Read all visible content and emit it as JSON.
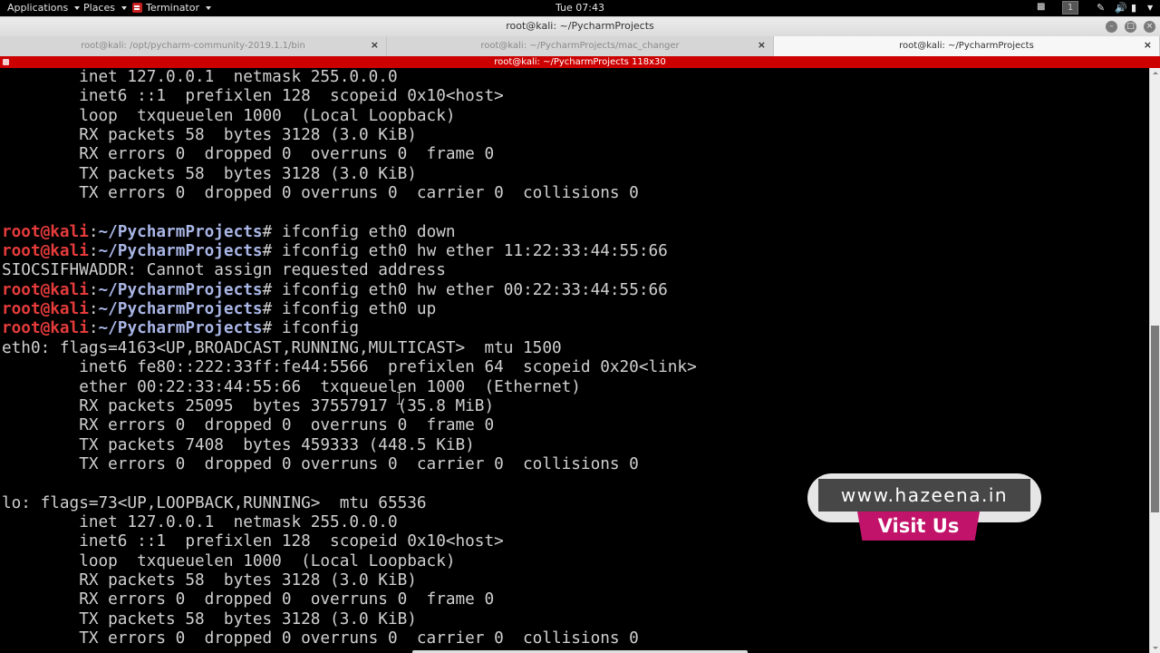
{
  "top_panel": {
    "applications_label": "Applications",
    "places_label": "Places",
    "terminator_label": "Terminator",
    "clock": "Tue 07:43",
    "workspace_number": "1"
  },
  "window": {
    "title": "root@kali: ~/PycharmProjects"
  },
  "tabs": [
    {
      "label": "root@kali: /opt/pycharm-community-2019.1.1/bin",
      "close": "×",
      "active": false
    },
    {
      "label": "root@kali: ~/PycharmProjects/mac_changer",
      "close": "×",
      "active": false
    },
    {
      "label": "root@kali: ~/PycharmProjects",
      "close": "×",
      "active": true
    }
  ],
  "terminal": {
    "title": "root@kali: ~/PycharmProjects 118x30",
    "prompt": {
      "user": "root@kali",
      "sep": ":",
      "path": "~/PycharmProjects",
      "symbol": "# "
    },
    "lines": [
      {
        "type": "out",
        "text": "        inet 127.0.0.1  netmask 255.0.0.0"
      },
      {
        "type": "out",
        "text": "        inet6 ::1  prefixlen 128  scopeid 0x10<host>"
      },
      {
        "type": "out",
        "text": "        loop  txqueuelen 1000  (Local Loopback)"
      },
      {
        "type": "out",
        "text": "        RX packets 58  bytes 3128 (3.0 KiB)"
      },
      {
        "type": "out",
        "text": "        RX errors 0  dropped 0  overruns 0  frame 0"
      },
      {
        "type": "out",
        "text": "        TX packets 58  bytes 3128 (3.0 KiB)"
      },
      {
        "type": "out",
        "text": "        TX errors 0  dropped 0 overruns 0  carrier 0  collisions 0"
      },
      {
        "type": "out",
        "text": ""
      },
      {
        "type": "cmd",
        "text": "ifconfig eth0 down"
      },
      {
        "type": "cmd",
        "text": "ifconfig eth0 hw ether 11:22:33:44:55:66"
      },
      {
        "type": "out",
        "text": "SIOCSIFHWADDR: Cannot assign requested address"
      },
      {
        "type": "cmd",
        "text": "ifconfig eth0 hw ether 00:22:33:44:55:66"
      },
      {
        "type": "cmd",
        "text": "ifconfig eth0 up"
      },
      {
        "type": "cmd",
        "text": "ifconfig"
      },
      {
        "type": "out",
        "text": "eth0: flags=4163<UP,BROADCAST,RUNNING,MULTICAST>  mtu 1500"
      },
      {
        "type": "out",
        "text": "        inet6 fe80::222:33ff:fe44:5566  prefixlen 64  scopeid 0x20<link>"
      },
      {
        "type": "out",
        "text": "        ether 00:22:33:44:55:66  txqueuelen 1000  (Ethernet)"
      },
      {
        "type": "out",
        "text": "        RX packets 25095  bytes 37557917 (35.8 MiB)"
      },
      {
        "type": "out",
        "text": "        RX errors 0  dropped 0  overruns 0  frame 0"
      },
      {
        "type": "out",
        "text": "        TX packets 7408  bytes 459333 (448.5 KiB)"
      },
      {
        "type": "out",
        "text": "        TX errors 0  dropped 0 overruns 0  carrier 0  collisions 0"
      },
      {
        "type": "out",
        "text": ""
      },
      {
        "type": "out",
        "text": "lo: flags=73<UP,LOOPBACK,RUNNING>  mtu 65536"
      },
      {
        "type": "out",
        "text": "        inet 127.0.0.1  netmask 255.0.0.0"
      },
      {
        "type": "out",
        "text": "        inet6 ::1  prefixlen 128  scopeid 0x10<host>"
      },
      {
        "type": "out",
        "text": "        loop  txqueuelen 1000  (Local Loopback)"
      },
      {
        "type": "out",
        "text": "        RX packets 58  bytes 3128 (3.0 KiB)"
      },
      {
        "type": "out",
        "text": "        RX errors 0  dropped 0  overruns 0  frame 0"
      },
      {
        "type": "out",
        "text": "        TX packets 58  bytes 3128 (3.0 KiB)"
      },
      {
        "type": "out",
        "text": "        TX errors 0  dropped 0 overruns 0  carrier 0  collisions 0"
      }
    ],
    "scroll_position": {
      "thumb_start_fraction": 0.44,
      "thumb_end_fraction": 0.76
    }
  },
  "watermark": {
    "url": "www.hazeena.in",
    "cta": "Visit Us"
  },
  "colors": {
    "terminal_titlebar": "#cc0000",
    "prompt_user": "#e53b3b",
    "prompt_path": "#a9b6e6",
    "watermark_accent": "#c2136a"
  }
}
